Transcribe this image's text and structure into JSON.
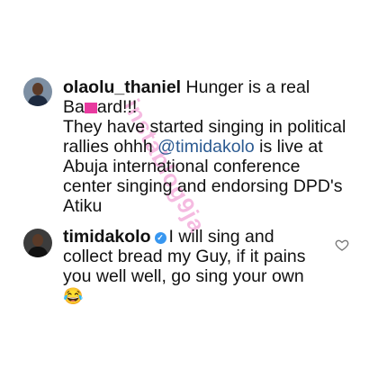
{
  "comments": [
    {
      "username": "olaolu_thaniel",
      "lines": [
        "Hunger is a real",
        "Ba",
        "ard!!!",
        "They have started singing in political",
        "rallies ohhh ",
        "@timidakolo",
        " is live at",
        "Abuja international conference",
        "center singing and endorsing DPD's",
        "Atiku"
      ]
    },
    {
      "username": "timidakolo",
      "verified": true,
      "lines": [
        "I will sing and",
        "collect bread my Guy, if it pains",
        "you well well, go sing your own"
      ],
      "emoji": "😂",
      "like_icon": "heart-outline-icon"
    }
  ],
  "watermark": "instablog9ja",
  "colors": {
    "mention": "#2c5b92",
    "verified": "#3897f0",
    "watermark": "#e23ca8"
  }
}
